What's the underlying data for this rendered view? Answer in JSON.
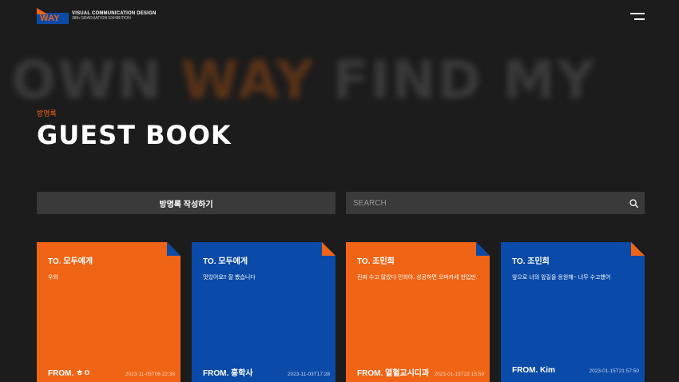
{
  "header": {
    "logo_badge": "WAY",
    "logo_line1": "VISUAL COMMUNICATION DESIGN",
    "logo_line2": "38th GRADUATION EXHIBITION",
    "menu_icon": "hamburger-menu-icon"
  },
  "marquee": {
    "word1": "OWN",
    "word2": "WAY",
    "word3": "FIND MY"
  },
  "page": {
    "subtitle": "방명록",
    "title": "GUEST BOOK"
  },
  "actions": {
    "write_label": "방명록 작성하기",
    "search_placeholder": "SEARCH",
    "search_icon": "search-icon"
  },
  "colors": {
    "background": "#1c1c1c",
    "orange": "#ef6415",
    "blue": "#0a4aa8",
    "panel": "#3a3a3a"
  },
  "cards": [
    {
      "to": "TO. 모두에게",
      "message": "우와",
      "from": "FROM. ㅎㅇ",
      "date": "2023-11-05T06:22:36",
      "color": "orange"
    },
    {
      "to": "TO. 모두에게",
      "message": "멋있어요!! 잘 봤습니다",
      "from": "FROM. 홍학사",
      "date": "2023-11-03T17:28",
      "color": "blue"
    },
    {
      "to": "TO. 조민희",
      "message": "진짜 수고 많았다 민희야. 성공하면 오마카세 한입만.",
      "from": "FROM. 열혈교시디과",
      "date": "2023-01-15T22:15:59",
      "color": "orange"
    },
    {
      "to": "TO. 조민희",
      "message": "앞으로 너의 앞길을 응원해~ 너무 수고했어",
      "from": "FROM. Kim",
      "date": "2023-01-15T21:57:50",
      "color": "blue"
    }
  ]
}
